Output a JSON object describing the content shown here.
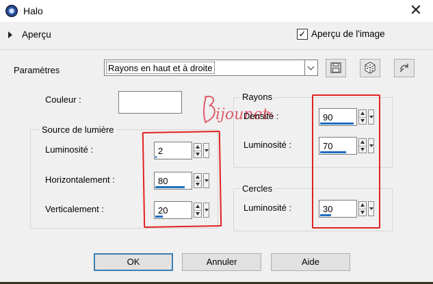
{
  "window": {
    "title": "Halo",
    "close_glyph": "✕"
  },
  "preview": {
    "label": "Aperçu",
    "checkbox_label": "Aperçu de l'image",
    "checkbox_checked": true,
    "check_glyph": "✓"
  },
  "params": {
    "label": "Paramètres",
    "preset_value": "Rayons en haut et à droite"
  },
  "toolbar": {
    "save_icon": "save-icon",
    "random_icon": "dice-icon",
    "reset_icon": "reset-icon"
  },
  "color": {
    "label": "Couleur :",
    "value": "#ffffff"
  },
  "light_source": {
    "title": "Source de lumière",
    "luminosity": {
      "label": "Luminosité :",
      "value": "2",
      "fraction": 0.02
    },
    "horizontal": {
      "label": "Horizontalement :",
      "value": "80",
      "fraction": 0.8
    },
    "vertical": {
      "label": "Verticalement :",
      "value": "20",
      "fraction": 0.2
    }
  },
  "rays": {
    "title": "Rayons",
    "density": {
      "label": "Densité :",
      "value": "90",
      "fraction": 0.9
    },
    "luminosity": {
      "label": "Luminosité :",
      "value": "70",
      "fraction": 0.7
    }
  },
  "circles": {
    "title": "Cercles",
    "luminosity": {
      "label": "Luminosité :",
      "value": "30",
      "fraction": 0.3
    }
  },
  "watermark": {
    "text": "Bijounet"
  },
  "buttons": {
    "ok": "OK",
    "cancel": "Annuler",
    "help": "Aide"
  },
  "colors": {
    "accent": "#1e6fbf",
    "highlight_box": "#e02020",
    "panel": "#f0f0f0"
  }
}
